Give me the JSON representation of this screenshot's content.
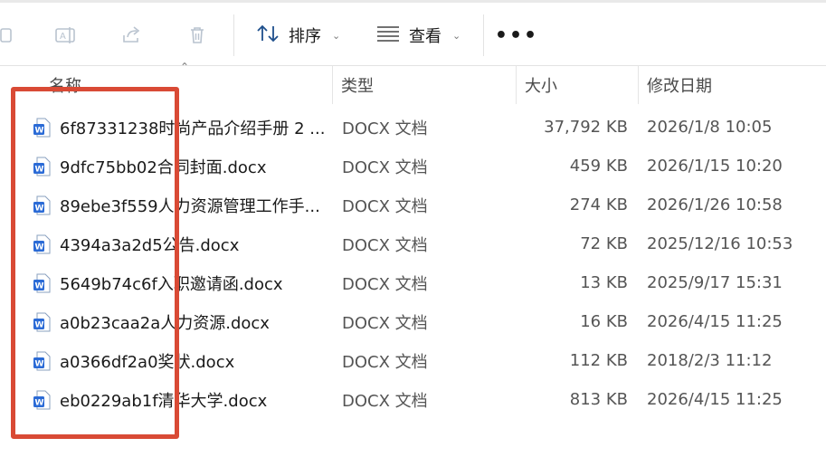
{
  "toolbar": {
    "icons": [
      "copy-icon",
      "rename-icon",
      "share-icon",
      "delete-icon"
    ],
    "sort_label": "排序",
    "view_label": "查看",
    "more_label": "•••"
  },
  "columns": {
    "name": "名称",
    "type": "类型",
    "size": "大小",
    "modified": "修改日期"
  },
  "files": [
    {
      "name": "6f87331238时尚产品介绍手册 2 ...",
      "type": "DOCX 文档",
      "size": "37,792 KB",
      "modified": "2026/1/8 10:05"
    },
    {
      "name": "9dfc75bb02合同封面.docx",
      "type": "DOCX 文档",
      "size": "459 KB",
      "modified": "2026/1/15 10:20"
    },
    {
      "name": "89ebe3f559人力资源管理工作手...",
      "type": "DOCX 文档",
      "size": "274 KB",
      "modified": "2026/1/26 10:58"
    },
    {
      "name": "4394a3a2d5公告.docx",
      "type": "DOCX 文档",
      "size": "72 KB",
      "modified": "2025/12/16 10:53"
    },
    {
      "name": "5649b74c6f入职邀请函.docx",
      "type": "DOCX 文档",
      "size": "13 KB",
      "modified": "2025/9/17 15:31"
    },
    {
      "name": "a0b23caa2a人力资源.docx",
      "type": "DOCX 文档",
      "size": "16 KB",
      "modified": "2026/4/15 11:25"
    },
    {
      "name": "a0366df2a0奖状.docx",
      "type": "DOCX 文档",
      "size": "112 KB",
      "modified": "2018/2/3 11:12"
    },
    {
      "name": "eb0229ab1f清华大学.docx",
      "type": "DOCX 文档",
      "size": "813 KB",
      "modified": "2026/4/15 11:25"
    }
  ],
  "colors": {
    "highlight": "#d94a35",
    "word_icon": "#2b6bd6"
  }
}
